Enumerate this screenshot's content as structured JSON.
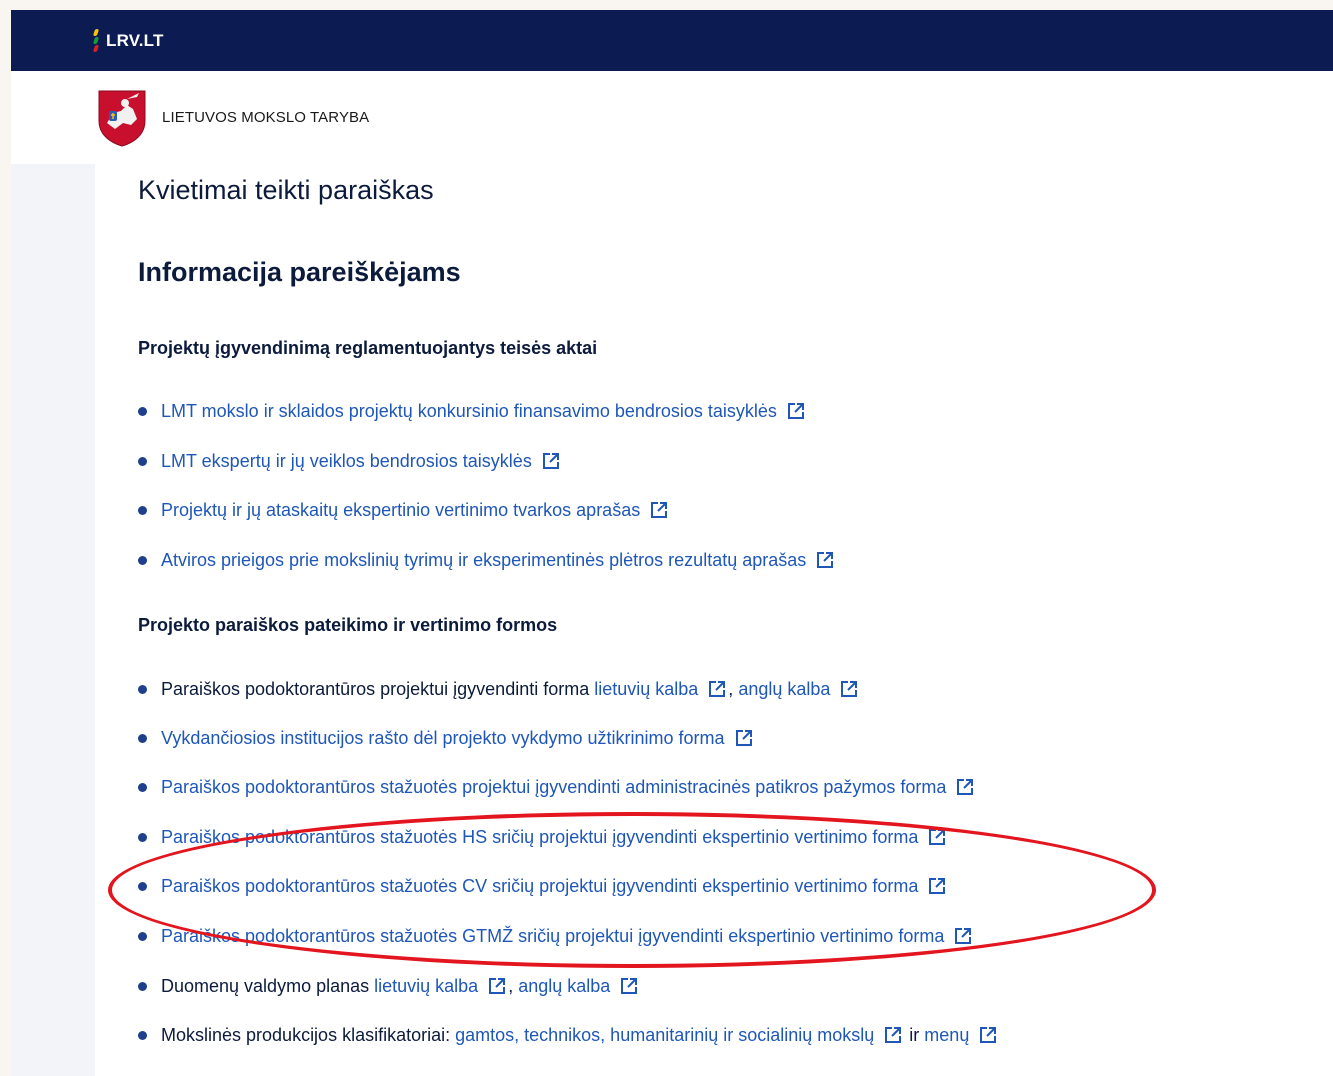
{
  "topbar": {
    "site_name": "LRV.LT",
    "flag_colors": [
      "#f6c20e",
      "#1b9a3c",
      "#d5202a"
    ]
  },
  "header": {
    "org_name": "LIETUVOS MOKSLO TARYBA",
    "crest_icon": "vytis-coat-of-arms-icon"
  },
  "main": {
    "title": "Kvietimai teikti paraiškas",
    "subtitle": "Informacija pareiškėjams",
    "sections": [
      {
        "heading": "Projektų įgyvendinimą reglamentuojantys teisės aktai",
        "items": [
          {
            "link": "LMT mokslo ir sklaidos projektų konkursinio finansavimo bendrosios taisyklės"
          },
          {
            "link": "LMT ekspertų ir jų veiklos bendrosios taisyklės"
          },
          {
            "link": "Projektų ir jų ataskaitų ekspertinio vertinimo tvarkos aprašas"
          },
          {
            "link": "Atviros prieigos prie mokslinių tyrimų ir eksperimentinės plėtros rezultatų aprašas"
          }
        ]
      },
      {
        "heading": "Projekto paraiškos pateikimo ir vertinimo formos",
        "items": [
          {
            "prefix": "Paraiškos podoktorantūros projektui įgyvendinti forma ",
            "link": "lietuvių kalba",
            "separator": ", ",
            "link2": "anglų kalba"
          },
          {
            "link": "Vykdančiosios institucijos rašto dėl projekto vykdymo užtikrinimo forma"
          },
          {
            "link": "Paraiškos podoktorantūros stažuotės projektui įgyvendinti administracinės patikros pažymos forma"
          },
          {
            "link": "Paraiškos podoktorantūros stažuotės HS sričių projektui įgyvendinti ekspertinio vertinimo forma"
          },
          {
            "link": "Paraiškos podoktorantūros stažuotės CV sričių projektui įgyvendinti ekspertinio vertinimo forma"
          },
          {
            "link": "Paraiškos podoktorantūros stažuotės GTMŽ sričių projektui įgyvendinti ekspertinio vertinimo forma"
          },
          {
            "prefix": "Duomenų valdymo planas ",
            "link": "lietuvių kalba",
            "separator": ", ",
            "link2": "anglų kalba"
          },
          {
            "prefix": "Mokslinės produkcijos klasifikatoriai: ",
            "link": "gamtos, technikos, humanitarinių ir socialinių mokslų",
            "separator": " ir ",
            "link2": "menų"
          }
        ]
      }
    ]
  },
  "colors": {
    "navy": "#0c1b52",
    "link": "#1f57b8",
    "annotation": "#e3161f"
  },
  "icons": {
    "external": "external-link-icon",
    "bullet": "bullet-dot"
  }
}
